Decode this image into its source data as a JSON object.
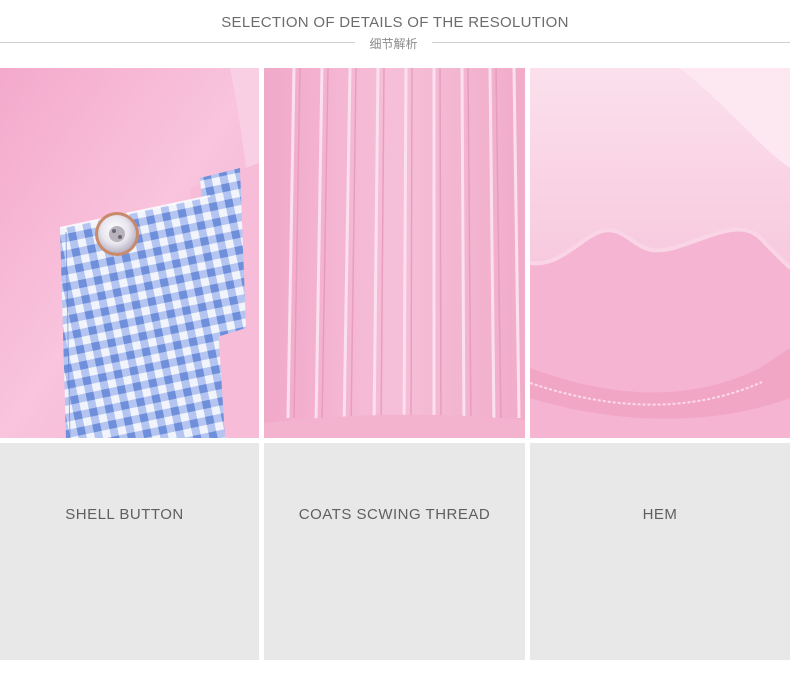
{
  "header": {
    "title": "SELECTION OF DETAILS OF THE RESOLUTION",
    "subtitle": "细节解析"
  },
  "details": [
    {
      "label": "SHELL BUTTON",
      "image": "pink-shirt-cuff-with-gingham-tab-and-shell-button"
    },
    {
      "label": "COATS SCWING THREAD",
      "image": "pink-shirt-pleated-placket-stitching"
    },
    {
      "label": "HEM",
      "image": "pink-shirt-curved-hem"
    }
  ],
  "colors": {
    "pink_fabric": "#f7b9d6",
    "gingham_blue": "#7f9fe0",
    "label_background": "#e8e8e8",
    "text_gray": "#5f5f5f"
  }
}
